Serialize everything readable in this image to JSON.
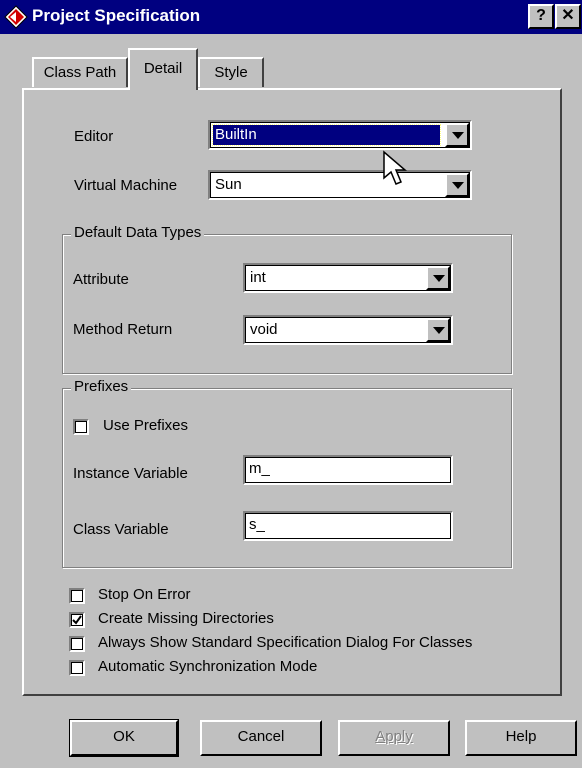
{
  "window": {
    "title": "Project Specification",
    "help_button": "?",
    "close_button": "✕"
  },
  "tabs": [
    {
      "label": "Class Path",
      "active": false
    },
    {
      "label": "Detail",
      "active": true
    },
    {
      "label": "Style",
      "active": false
    }
  ],
  "detail": {
    "editor_label": "Editor",
    "editor_value": "BuiltIn",
    "vm_label": "Virtual Machine",
    "vm_value": "Sun",
    "default_types": {
      "title": "Default Data Types",
      "attribute_label": "Attribute",
      "attribute_value": "int",
      "method_return_label": "Method Return",
      "method_return_value": "void"
    },
    "prefixes": {
      "title": "Prefixes",
      "use_prefixes_label": "Use Prefixes",
      "use_prefixes_checked": false,
      "instance_label": "Instance Variable",
      "instance_value": "m_",
      "class_label": "Class Variable",
      "class_value": "s_"
    },
    "options": [
      {
        "label": "Stop On Error",
        "checked": false
      },
      {
        "label": "Create Missing Directories",
        "checked": true
      },
      {
        "label": "Always Show Standard Specification Dialog For Classes",
        "checked": false
      },
      {
        "label": "Automatic Synchronization Mode",
        "checked": false
      }
    ]
  },
  "buttons": {
    "ok": "OK",
    "cancel": "Cancel",
    "apply": "Apply",
    "help": "Help"
  },
  "colors": {
    "titlebar": "#000080",
    "face": "#c0c0c0",
    "selection": "#000080"
  }
}
